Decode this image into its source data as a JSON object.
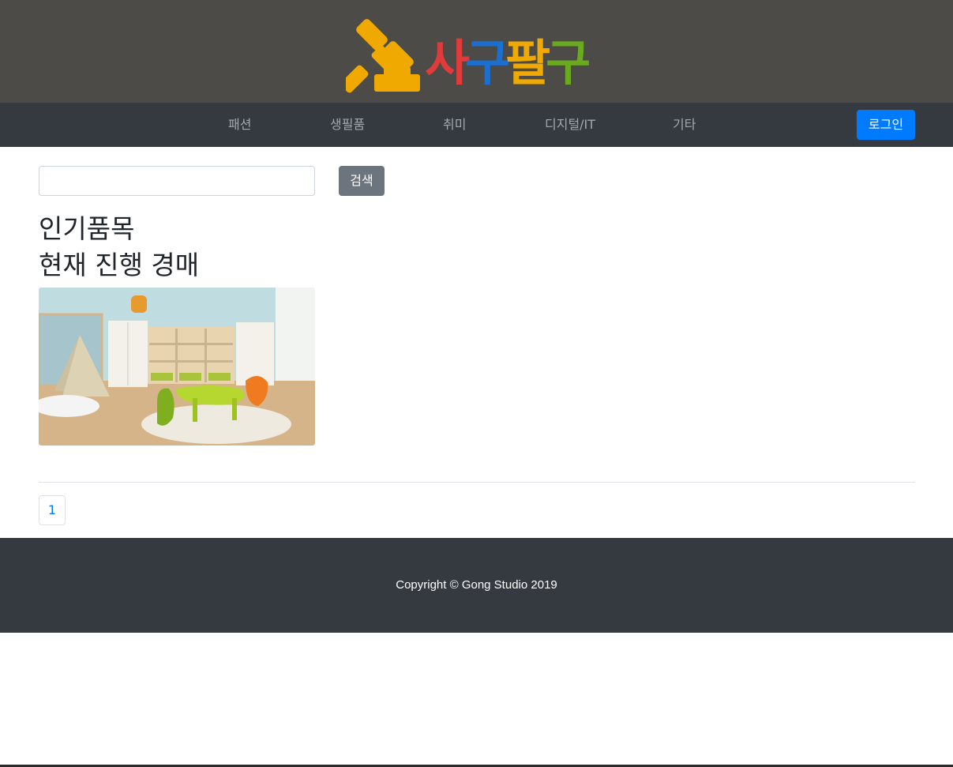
{
  "header": {
    "logo": {
      "icon": "gavel-icon",
      "chars": [
        {
          "text": "사",
          "color": "#e03a3a"
        },
        {
          "text": "구",
          "color": "#1a6fd1"
        },
        {
          "text": "팔",
          "color": "#f0a900"
        },
        {
          "text": "구",
          "color": "#6aaa1e"
        }
      ],
      "colors": {
        "gavel": "#f0a900"
      }
    }
  },
  "nav": {
    "items": [
      {
        "label": "패션"
      },
      {
        "label": "생필품"
      },
      {
        "label": "취미"
      },
      {
        "label": "디지털/IT"
      },
      {
        "label": "기타"
      }
    ],
    "login_label": "로그인"
  },
  "search": {
    "value": "",
    "placeholder": "",
    "button_label": "검색"
  },
  "sections": {
    "popular_title": "인기품목",
    "live_title": "현재 진행 경매"
  },
  "pagination": {
    "pages": [
      "1"
    ]
  },
  "footer": {
    "copyright": "Copyright © Gong Studio 2019"
  },
  "colors": {
    "header_bg": "#4d4b48",
    "nav_bg": "#343a40",
    "primary": "#007bff",
    "secondary": "#6c757d"
  }
}
